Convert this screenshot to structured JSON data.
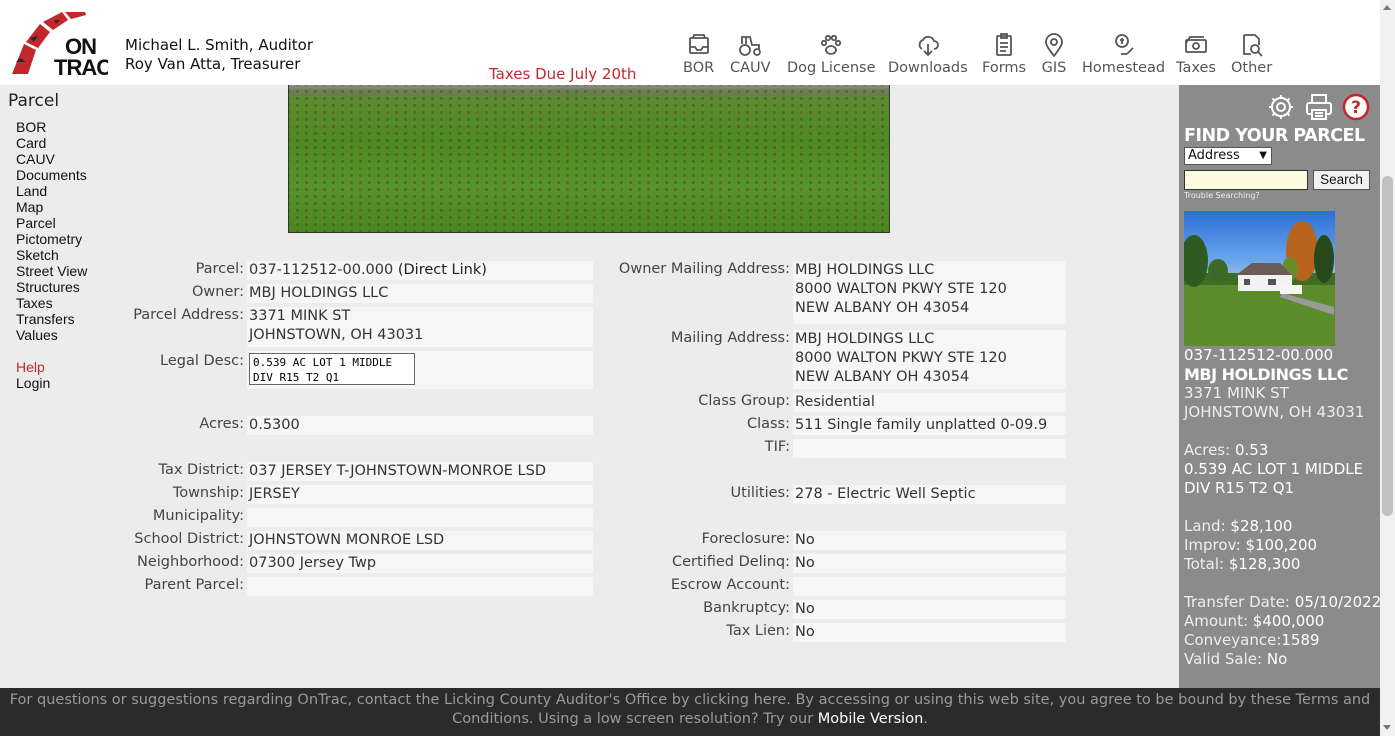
{
  "header": {
    "logo_text": "ON TRAC",
    "auditor": "Michael L. Smith, Auditor",
    "treasurer": "Roy Van Atta, Treasurer",
    "notice": "Taxes Due July 20th",
    "nav": [
      {
        "label": "BOR",
        "icon": "inbox-icon"
      },
      {
        "label": "CAUV",
        "icon": "tractor-icon"
      },
      {
        "label": "Dog License",
        "icon": "paw-icon"
      },
      {
        "label": "Downloads",
        "icon": "cloud-download-icon"
      },
      {
        "label": "Forms",
        "icon": "clipboard-icon"
      },
      {
        "label": "GIS",
        "icon": "map-pin-icon"
      },
      {
        "label": "Homestead",
        "icon": "money-hand-icon"
      },
      {
        "label": "Taxes",
        "icon": "cash-icon"
      },
      {
        "label": "Other",
        "icon": "search-doc-icon"
      }
    ]
  },
  "sidenav": {
    "title": "Parcel",
    "links": [
      "BOR",
      "Card",
      "CAUV",
      "Documents",
      "Land",
      "Map",
      "Parcel",
      "Pictometry",
      "Sketch",
      "Street View",
      "Structures",
      "Taxes",
      "Transfers",
      "Values"
    ],
    "help": "Help",
    "login": "Login"
  },
  "details_left": {
    "parcel": {
      "label": "Parcel:",
      "value": "037-112512-00.000",
      "link": "(Direct Link)"
    },
    "owner": {
      "label": "Owner:",
      "value": "MBJ HOLDINGS LLC"
    },
    "address": {
      "label": "Parcel Address:",
      "line1": "3371 MINK ST",
      "line2": "JOHNSTOWN, OH 43031"
    },
    "legal": {
      "label": "Legal Desc:",
      "value": "0.539 AC LOT 1 MIDDLE DIV R15 T2 Q1"
    },
    "acres": {
      "label": "Acres:",
      "value": "0.5300"
    },
    "tax_district": {
      "label": "Tax District:",
      "value": "037 JERSEY T-JOHNSTOWN-MONROE LSD"
    },
    "township": {
      "label": "Township:",
      "value": "JERSEY"
    },
    "municipality": {
      "label": "Municipality:",
      "value": ""
    },
    "school": {
      "label": "School District:",
      "value": "JOHNSTOWN MONROE LSD"
    },
    "neighborhood": {
      "label": "Neighborhood:",
      "value": "07300 Jersey Twp"
    },
    "parent": {
      "label": "Parent Parcel:",
      "value": ""
    }
  },
  "details_right": {
    "owner_mailing": {
      "label": "Owner Mailing Address:",
      "line1": "MBJ HOLDINGS LLC",
      "line2": "8000 WALTON PKWY STE 120",
      "line3": "NEW ALBANY OH 43054"
    },
    "mailing": {
      "label": "Mailing Address:",
      "line1": "MBJ HOLDINGS LLC",
      "line2": "8000 WALTON PKWY STE 120",
      "line3": "NEW ALBANY OH 43054"
    },
    "class_group": {
      "label": "Class Group:",
      "value": "Residential"
    },
    "class": {
      "label": "Class:",
      "value": "511 Single family unplatted 0-09.9"
    },
    "tif": {
      "label": "TIF:",
      "value": ""
    },
    "utilities": {
      "label": "Utilities:",
      "value": "278 - Electric Well Septic"
    },
    "foreclosure": {
      "label": "Foreclosure:",
      "value": "No"
    },
    "certified": {
      "label": "Certified Delinq:",
      "value": "No"
    },
    "escrow": {
      "label": "Escrow Account:",
      "value": ""
    },
    "bankruptcy": {
      "label": "Bankruptcy:",
      "value": "No"
    },
    "tax_lien": {
      "label": "Tax Lien:",
      "value": "No"
    }
  },
  "sidebar": {
    "find_title": "FIND YOUR PARCEL",
    "search_type": "Address",
    "search_value": "",
    "search_button": "Search",
    "trouble": "Trouble Searching?",
    "parcel": "037-112512-00.000",
    "owner": "MBJ HOLDINGS LLC",
    "addr1": "3371 MINK ST",
    "addr2": "JOHNSTOWN, OH 43031",
    "acres_label": "Acres:",
    "acres": "0.53",
    "legal1": "0.539 AC LOT 1 MIDDLE",
    "legal2": "DIV R15 T2 Q1",
    "land_label": "Land:",
    "land": "$28,100",
    "improv_label": "Improv:",
    "improv": "$100,200",
    "total_label": "Total:",
    "total": "$128,300",
    "transfer_label": "Transfer Date:",
    "transfer": "05/10/2022",
    "amount_label": "Amount:",
    "amount": "$400,000",
    "conveyance_label": "Conveyance:",
    "conveyance": "1589",
    "valid_label": "Valid Sale:",
    "valid": "No"
  },
  "footer": {
    "line1": "For questions or suggestions regarding OnTrac, contact the Licking County Auditor's Office by clicking here. By accessing or using this web site, you agree to be bound by these Terms and",
    "line2": "Conditions. Using a low screen resolution? Try our",
    "mobile": "Mobile Version",
    "end": "."
  },
  "colors": {
    "accent": "#c1272d",
    "sidebar": "#8b8b8b",
    "footer": "#2b2b2b"
  }
}
